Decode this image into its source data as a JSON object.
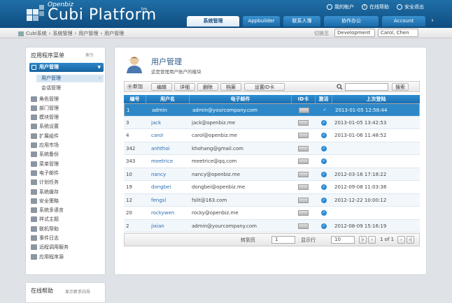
{
  "header": {
    "brand_small": "Openbiz",
    "brand_big": "Cubi Platform",
    "brand_tm": "tm",
    "my_account": "我的帐户",
    "online_help": "在线帮助",
    "logout": "安全退出",
    "tabs": [
      "系统管理",
      "Appbuilder",
      "联系人簿",
      "协作办公",
      "Account"
    ]
  },
  "breadcrumb": {
    "items": [
      "Cubi系统",
      "系统管理",
      "用户管理",
      "用户管理"
    ],
    "switch_label": "切换至",
    "env_value": "Development",
    "user_value": "Carol, Chen"
  },
  "sidebar": {
    "title": "应用程序菜单",
    "index_label": "索引",
    "module": "用户管理",
    "sub_active": "用户管理",
    "sub_2": "会话管理",
    "items": [
      "角色管理",
      "部门管理",
      "模块管理",
      "系统设置",
      "扩展组件",
      "应用市场",
      "系统备份",
      "菜单管理",
      "电子邮件",
      "计划任务",
      "系统缓存",
      "安全策略",
      "系统多语言",
      "样式主题",
      "联机帮助",
      "事件日志",
      "远程调用服务",
      "应用程序源"
    ]
  },
  "help": {
    "title": "在线帮助",
    "guide": "显示新手向导"
  },
  "main": {
    "title": "用户管理",
    "desc": "这是管理用户账户的模块",
    "toolbar": {
      "add": "新加",
      "edit": "编辑",
      "detail": "详细",
      "delete": "删除",
      "archive": "档案",
      "set_id": "设置ID卡",
      "search": "搜索"
    },
    "columns": [
      "编号",
      "用户名",
      "电子邮件",
      "ID卡",
      "激活",
      "上次登陆"
    ],
    "rows": [
      {
        "id": "1",
        "username": "admin",
        "email": "admin@yourcompany.com",
        "last_login": "2013-01-05 12:58:44"
      },
      {
        "id": "3",
        "username": "jack",
        "email": "jack@openbiz.me",
        "last_login": "2013-01-05 13:42:53"
      },
      {
        "id": "4",
        "username": "carol",
        "email": "carol@openbiz.me",
        "last_login": "2013-01-06 11:48:52"
      },
      {
        "id": "342",
        "username": "anhthoi",
        "email": "khohang@gmail.com",
        "last_login": ""
      },
      {
        "id": "343",
        "username": "meetrice",
        "email": "meetrice@qq.com",
        "last_login": ""
      },
      {
        "id": "10",
        "username": "nancy",
        "email": "nancy@openbiz.me",
        "last_login": "2012-03-16 17:18:22"
      },
      {
        "id": "19",
        "username": "dongbei",
        "email": "dongbei@openbiz.me",
        "last_login": "2012-09-08 11:03:38"
      },
      {
        "id": "12",
        "username": "fengsl",
        "email": "fslit@163.com",
        "last_login": "2012-12-22 10:00:12"
      },
      {
        "id": "20",
        "username": "rockywen",
        "email": "rocky@openbiz.me",
        "last_login": ""
      },
      {
        "id": "2",
        "username": "jixian",
        "email": "admin@yourcompany.com",
        "last_login": "2012-08-09 15:16:19"
      }
    ],
    "pager": {
      "goto_label": "转到页",
      "page_value": "1",
      "show_label": "显示行",
      "rows_value": "10",
      "page_info": "1 of 1"
    }
  },
  "colors": {
    "accent": "#1a6fb3",
    "selected_row": "#2e88c8"
  }
}
